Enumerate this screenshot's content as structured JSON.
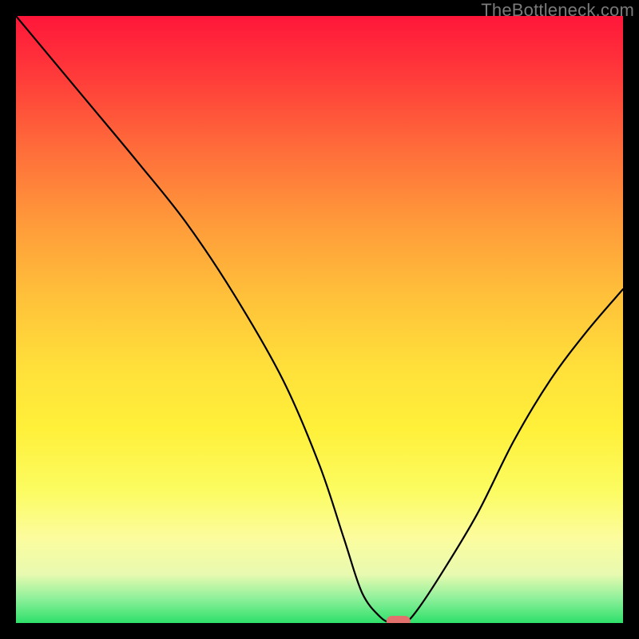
{
  "watermark": "TheBottleneck.com",
  "colors": {
    "frame": "#000000",
    "gradient_top": "#ff163a",
    "gradient_bottom": "#2ee06a",
    "curve": "#000000",
    "marker": "#e2716e"
  },
  "chart_data": {
    "type": "line",
    "title": "",
    "xlabel": "",
    "ylabel": "",
    "xlim": [
      0,
      100
    ],
    "ylim": [
      0,
      100
    ],
    "x": [
      0,
      10,
      20,
      28,
      36,
      44,
      50,
      54,
      57,
      60,
      62,
      64,
      66,
      70,
      76,
      82,
      88,
      94,
      100
    ],
    "values": [
      100,
      88,
      76,
      66,
      54,
      40,
      26,
      14,
      5,
      1,
      0,
      0,
      2,
      8,
      18,
      30,
      40,
      48,
      55
    ],
    "marker": {
      "x": 63,
      "y": 0
    },
    "annotations": []
  }
}
